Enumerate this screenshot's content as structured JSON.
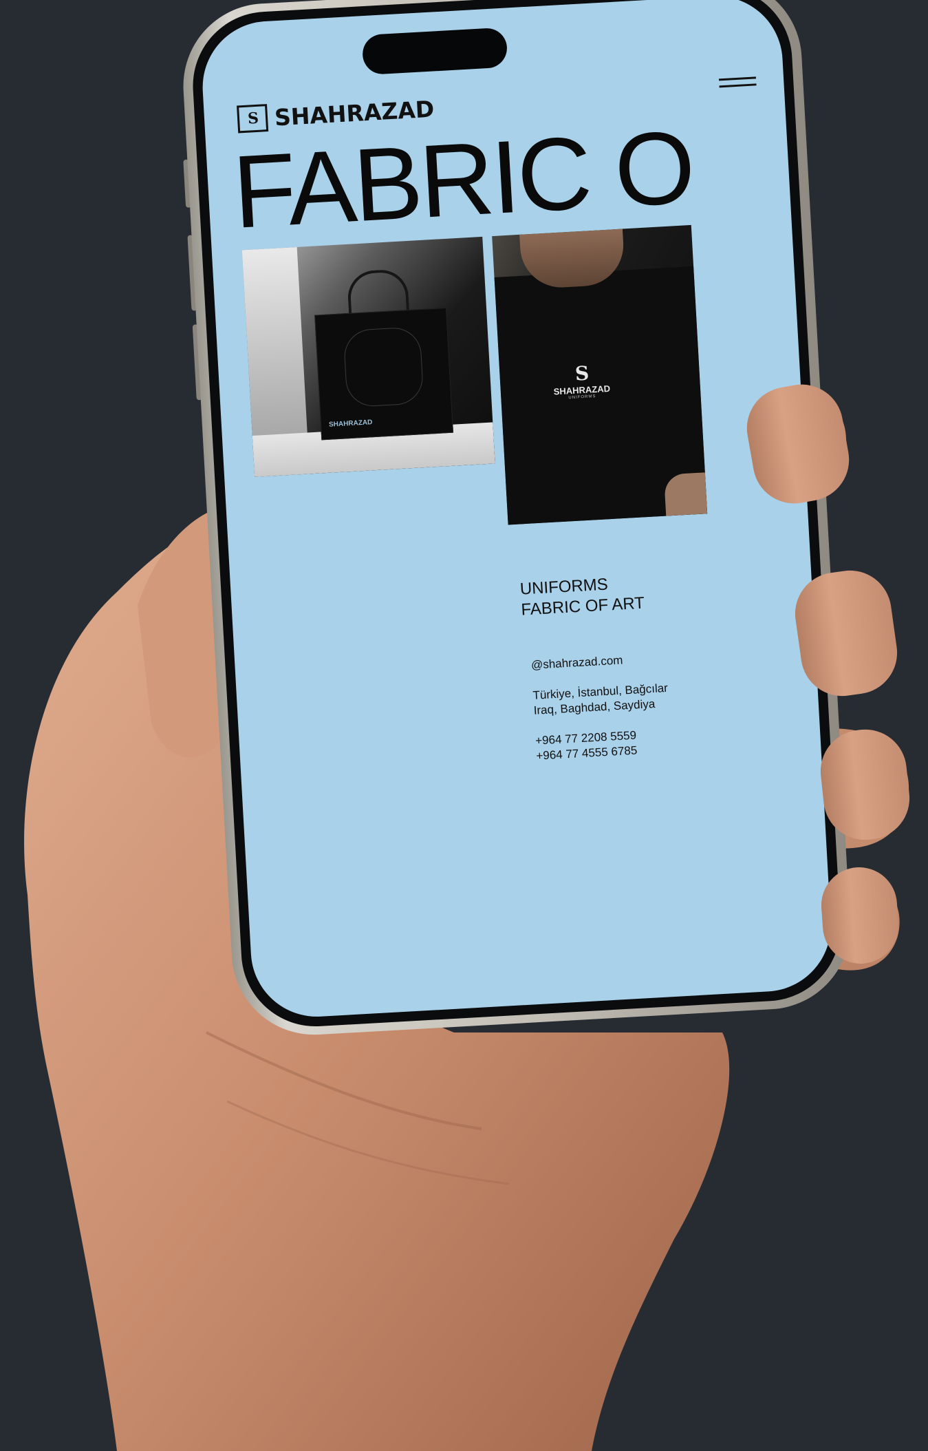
{
  "brand": {
    "logo_mark": "S",
    "name": "SHAHRAZAD"
  },
  "hero": {
    "headline": "FABRIC O"
  },
  "photo_shirt": {
    "logo_name": "SHAHRAZAD",
    "logo_sub": "UNIFORMS"
  },
  "photo_bag": {
    "label": "SHAHRAZAD"
  },
  "tagline": {
    "line1": "UNIFORMS",
    "line2": "FABRIC OF ART"
  },
  "contact": {
    "email": "@shahrazad.com",
    "address1": "Türkiye, İstanbul, Bağcılar",
    "address2": "Iraq, Baghdad, Saydiya",
    "phone1": "+964 77 2208 5559",
    "phone2": "+964 77 4555 6785"
  },
  "colors": {
    "background": "#272c33",
    "screen": "#a9d1e9",
    "text": "#111111"
  }
}
